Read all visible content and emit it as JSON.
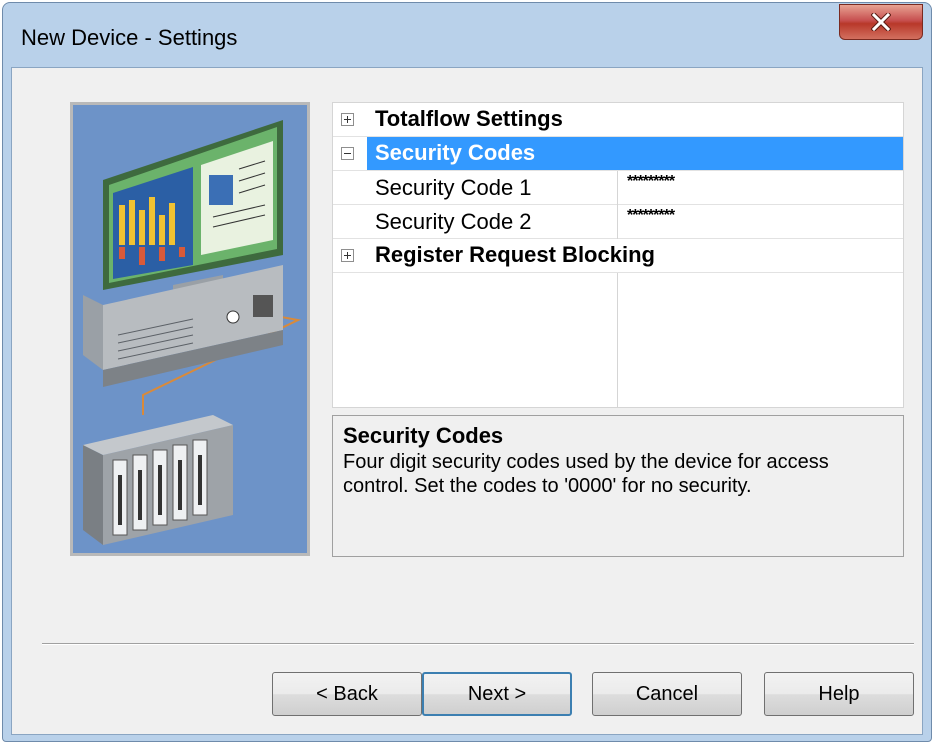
{
  "window": {
    "title": "New Device - Settings",
    "close_icon": "close-x-icon"
  },
  "illustration": {
    "description_icon": "computer-network-illustration"
  },
  "property_grid": {
    "groups": [
      {
        "label": "Totalflow Settings",
        "expanded": false,
        "icon": "plus-expander-icon"
      },
      {
        "label": "Security Codes",
        "expanded": true,
        "selected": true,
        "icon": "minus-expander-icon"
      },
      {
        "label": "Register Request Blocking",
        "expanded": false,
        "icon": "plus-expander-icon"
      }
    ],
    "properties": [
      {
        "name": "Security Code 1",
        "value": "*********"
      },
      {
        "name": "Security Code 2",
        "value": "*********"
      }
    ]
  },
  "description": {
    "title": "Security Codes",
    "text": "Four digit security codes used by the device for access control. Set the codes to '0000' for no security."
  },
  "buttons": {
    "back": "< Back",
    "next": "Next >",
    "cancel": "Cancel",
    "help": "Help"
  },
  "colors": {
    "selection": "#3399ff",
    "frame": "#b9d1ea",
    "client": "#f0f0f0",
    "close_button": "#c75050"
  }
}
